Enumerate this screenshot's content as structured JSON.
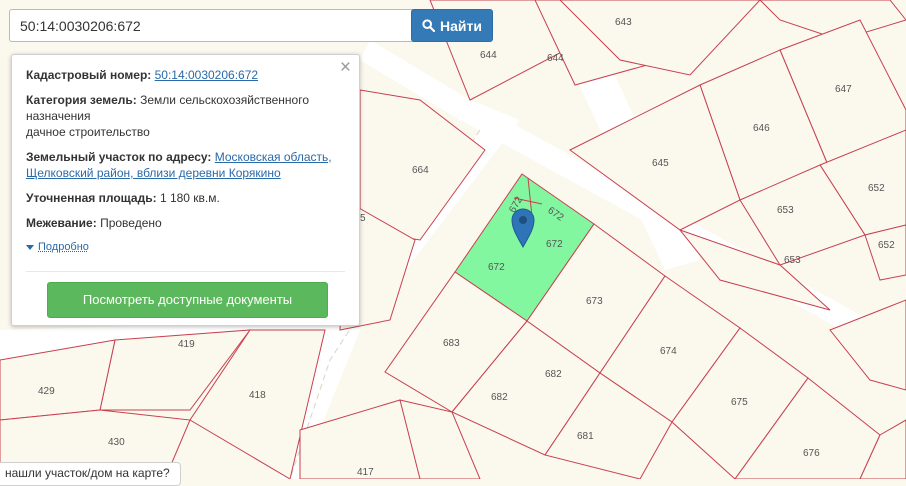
{
  "search": {
    "value": "50:14:0030206:672",
    "button_label": "Найти",
    "button_icon": "search-icon"
  },
  "popup": {
    "cadastral_label": "Кадастровый номер:",
    "cadastral_value": "50:14:0030206:672",
    "category_label": "Категория земель:",
    "category_value_1": "Земли сельскохозяйственного",
    "category_value_2": "назначения",
    "category_value_3": "дачное строительство",
    "address_label": "Земельный участок по адресу:",
    "address_value_1": "Московская область,",
    "address_value_2": "Щелковский район, вблизи деревни Корякино",
    "area_label": "Уточненная площадь:",
    "area_value": "1 180 кв.м.",
    "survey_label": "Межевание:",
    "survey_value": "Проведено",
    "more_label": "Подробно",
    "docs_button": "Посмотреть доступные документы",
    "close_glyph": "×"
  },
  "bottom_tip": "нашли участок/дом на карте?",
  "map": {
    "selected_parcel": "672",
    "parcel_labels": [
      "643",
      "644",
      "644",
      "647",
      "646",
      "645",
      "652",
      "652",
      "653",
      "653",
      "664",
      "5",
      "672",
      "672",
      "672",
      "672",
      "673",
      "683",
      "682",
      "682",
      "674",
      "675",
      "681",
      "676",
      "419",
      "418",
      "429",
      "430",
      "417"
    ],
    "colors": {
      "selected_fill": "#83f7a0",
      "boundary": "#c7404f",
      "marker": "#2f74b6"
    }
  }
}
